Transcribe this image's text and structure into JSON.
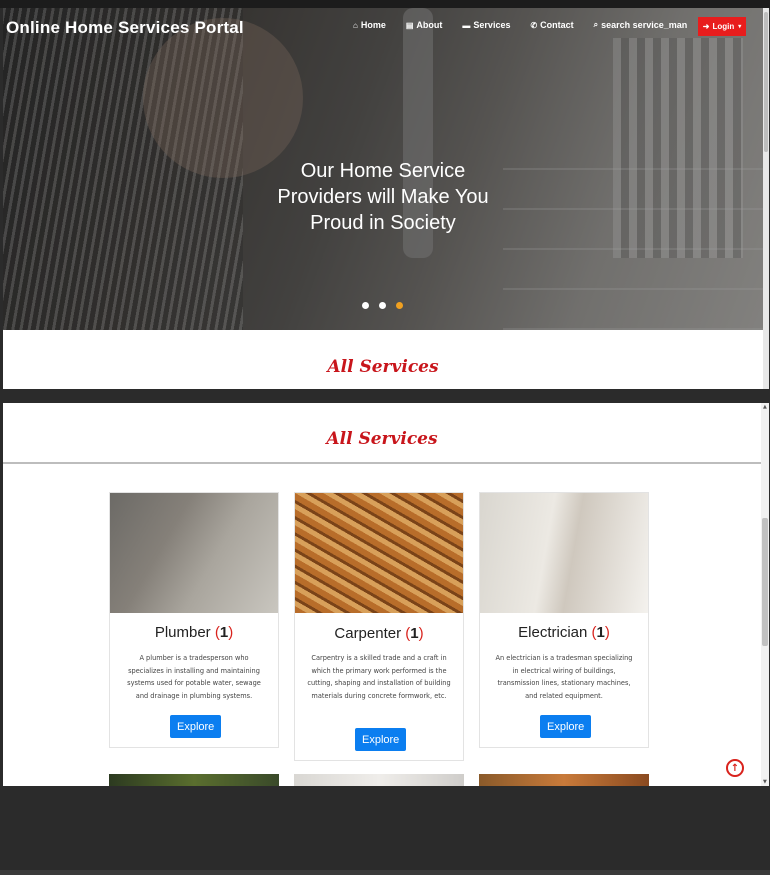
{
  "header": {
    "brand": "Online Home Services Portal",
    "nav": [
      {
        "label": "Home",
        "icon": "home-icon"
      },
      {
        "label": "About",
        "icon": "file-icon"
      },
      {
        "label": "Services",
        "icon": "briefcase-icon"
      },
      {
        "label": "Contact",
        "icon": "phone-icon"
      },
      {
        "label": "search service_man",
        "icon": "search-icon"
      }
    ],
    "login_label": "Login",
    "login_color": "#e81d1d"
  },
  "hero": {
    "line1": "Our Home Service",
    "line2": "Providers will Make You",
    "line3": "Proud in Society",
    "slides": 3,
    "active_slide": 3
  },
  "services_title": "All Services",
  "services": [
    {
      "name": "Plumber",
      "count": "1",
      "description": "A plumber is a tradesperson who specializes in installing and maintaining systems used for potable water, sewage and drainage in plumbing systems.",
      "button": "Explore"
    },
    {
      "name": "Carpenter",
      "count": "1",
      "description": "Carpentry is a skilled trade and a craft in which the primary work performed is the cutting, shaping and installation of building materials during concrete formwork, etc.",
      "button": "Explore"
    },
    {
      "name": "Electrician",
      "count": "1",
      "description": "An electrician is a tradesman specializing in electrical wiring of buildings, transmission lines, stationary machines, and related equipment.",
      "button": "Explore"
    }
  ],
  "colors": {
    "accent_red": "#c8151b",
    "button_blue": "#0b7ef0"
  }
}
